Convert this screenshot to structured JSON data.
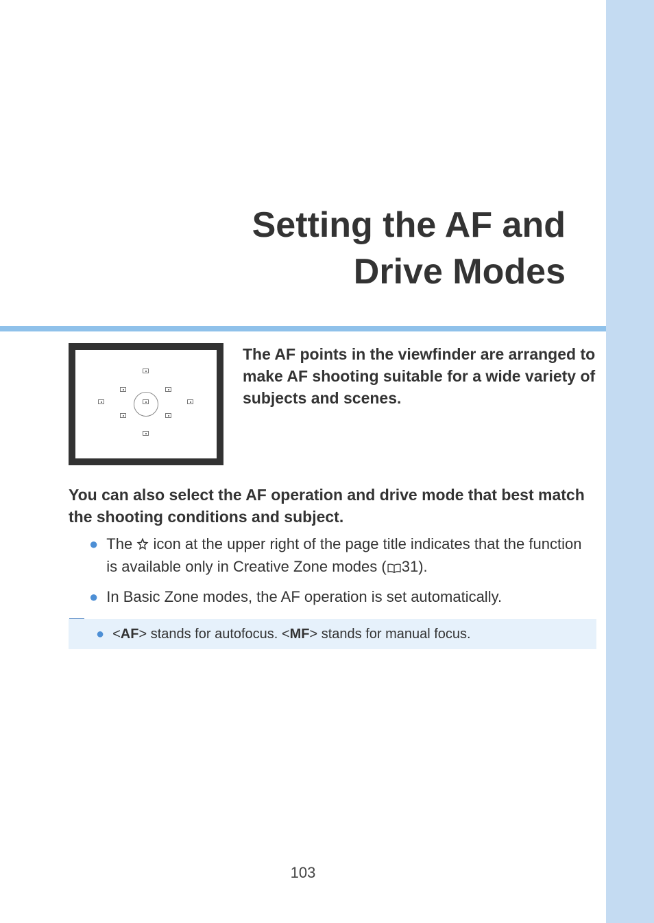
{
  "title": {
    "line1": "Setting the AF and",
    "line2": "Drive Modes"
  },
  "intro": "The AF points in the viewfinder are arranged to make AF shooting suitable for a wide variety of subjects and scenes.",
  "para2": "You can also select the AF operation and drive mode that best match the shooting conditions and subject.",
  "bullets": [
    {
      "pre": "The ",
      "after_star": " icon at the upper right of the page title indicates that the function is available only in Creative Zone modes (",
      "page_ref": "31",
      "suffix": ")."
    },
    {
      "text": "In Basic Zone modes, the AF operation is set automatically."
    }
  ],
  "note": {
    "pre": "<",
    "af": "AF",
    "mid1": "> stands for autofocus. <",
    "mf": "MF",
    "mid2": "> stands for manual focus."
  },
  "page_number": "103"
}
